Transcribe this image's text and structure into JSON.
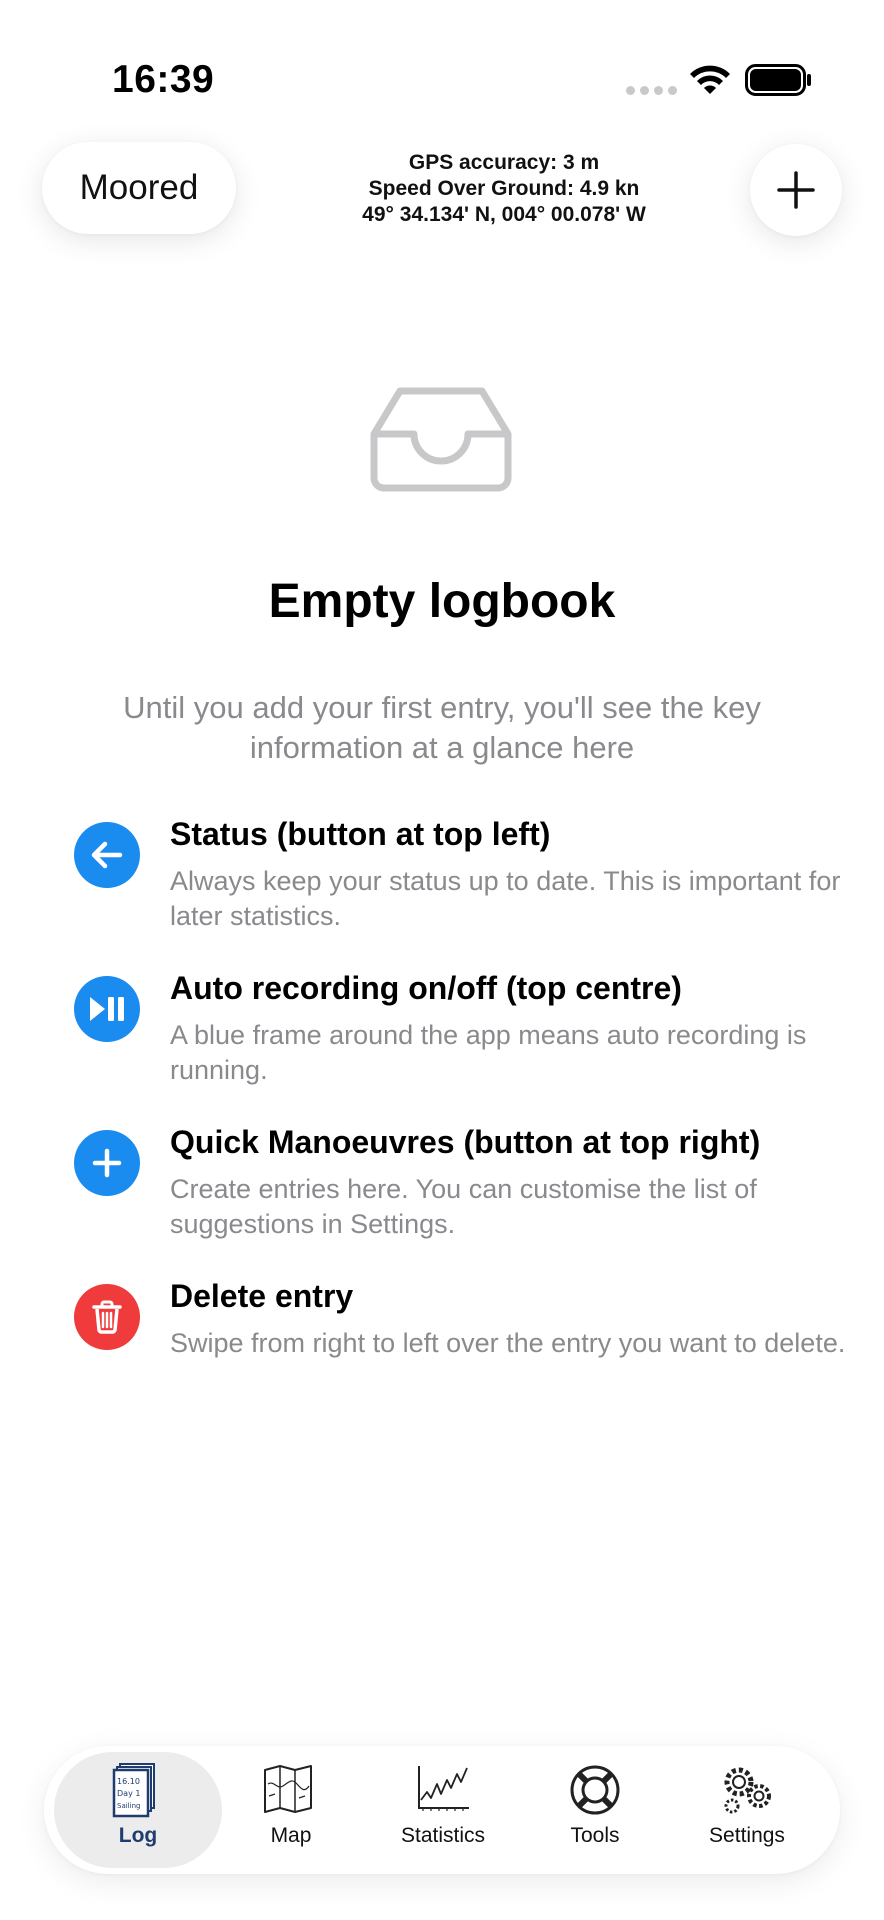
{
  "status_bar": {
    "time": "16:39",
    "icons": [
      "signal-dots-icon",
      "wifi-icon",
      "battery-icon"
    ]
  },
  "header": {
    "status_button": "Moored",
    "gps_accuracy": "GPS accuracy: 3 m",
    "speed_over_ground": "Speed Over Ground: 4.9 kn",
    "position": "49° 34.134' N, 004° 00.078' W",
    "add_button_icon": "plus-icon"
  },
  "empty_state": {
    "icon": "tray-icon",
    "title": "Empty logbook",
    "subtitle": "Until you add your first entry, you'll see the key information at a glance here"
  },
  "tips": [
    {
      "icon": "arrow-left-icon",
      "color": "#1a8cf0",
      "title": "Status (button at top left)",
      "description": "Always keep your status up to date. This is important for later statistics."
    },
    {
      "icon": "play-pause-icon",
      "color": "#1a8cf0",
      "title": "Auto recording on/off (top centre)",
      "description": "A blue frame around the app means auto recording is running."
    },
    {
      "icon": "plus-icon",
      "color": "#1a8cf0",
      "title": "Quick Manoeuvres (button at top right)",
      "description": "Create entries here. You can customise the list of suggestions in Settings."
    },
    {
      "icon": "trash-icon",
      "color": "#ef3b3b",
      "title": "Delete entry",
      "description": "Swipe from right to left over the entry you want to delete."
    }
  ],
  "tab_bar": {
    "active": "Log",
    "tabs": [
      {
        "label": "Log",
        "icon": "logbook-icon"
      },
      {
        "label": "Map",
        "icon": "map-icon"
      },
      {
        "label": "Statistics",
        "icon": "statistics-chart-icon"
      },
      {
        "label": "Tools",
        "icon": "lifebuoy-icon"
      },
      {
        "label": "Settings",
        "icon": "gears-icon"
      }
    ],
    "log_icon_text": [
      "16.10",
      "Day 1",
      "Sailing"
    ]
  }
}
